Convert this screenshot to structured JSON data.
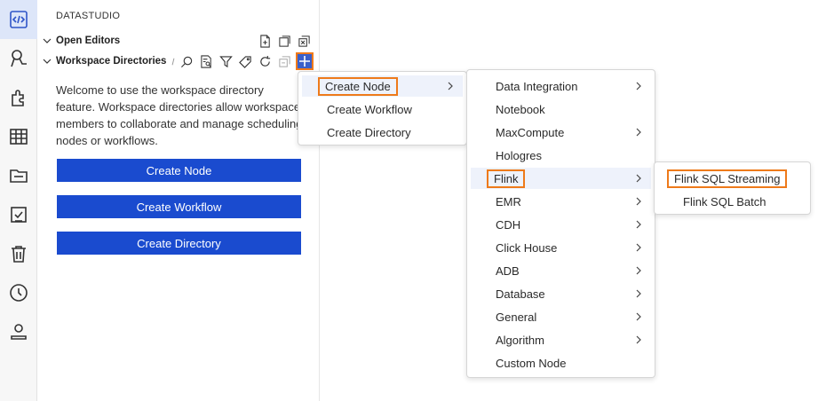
{
  "sidebar": {
    "title": "DATASTUDIO",
    "open_editors": "Open Editors",
    "workspace_dirs": "Workspace Directories",
    "welcome_text": "Welcome to use the workspace directory feature. Workspace directories allow workspace members to collaborate and manage scheduling nodes or workflows.",
    "buttons": {
      "create_node": "Create Node",
      "create_workflow": "Create Workflow",
      "create_directory": "Create Directory"
    }
  },
  "menu1": {
    "items": [
      "Create Node",
      "Create Workflow",
      "Create Directory"
    ]
  },
  "menu2": {
    "items": [
      "Data Integration",
      "Notebook",
      "MaxCompute",
      "Hologres",
      "Flink",
      "EMR",
      "CDH",
      "Click House",
      "ADB",
      "Database",
      "General",
      "Algorithm",
      "Custom Node"
    ]
  },
  "menu3": {
    "items": [
      "Flink SQL Streaming",
      "Flink SQL Batch"
    ]
  },
  "colors": {
    "accent": "#1a4bcf",
    "highlight_box": "#ee7a1a"
  }
}
